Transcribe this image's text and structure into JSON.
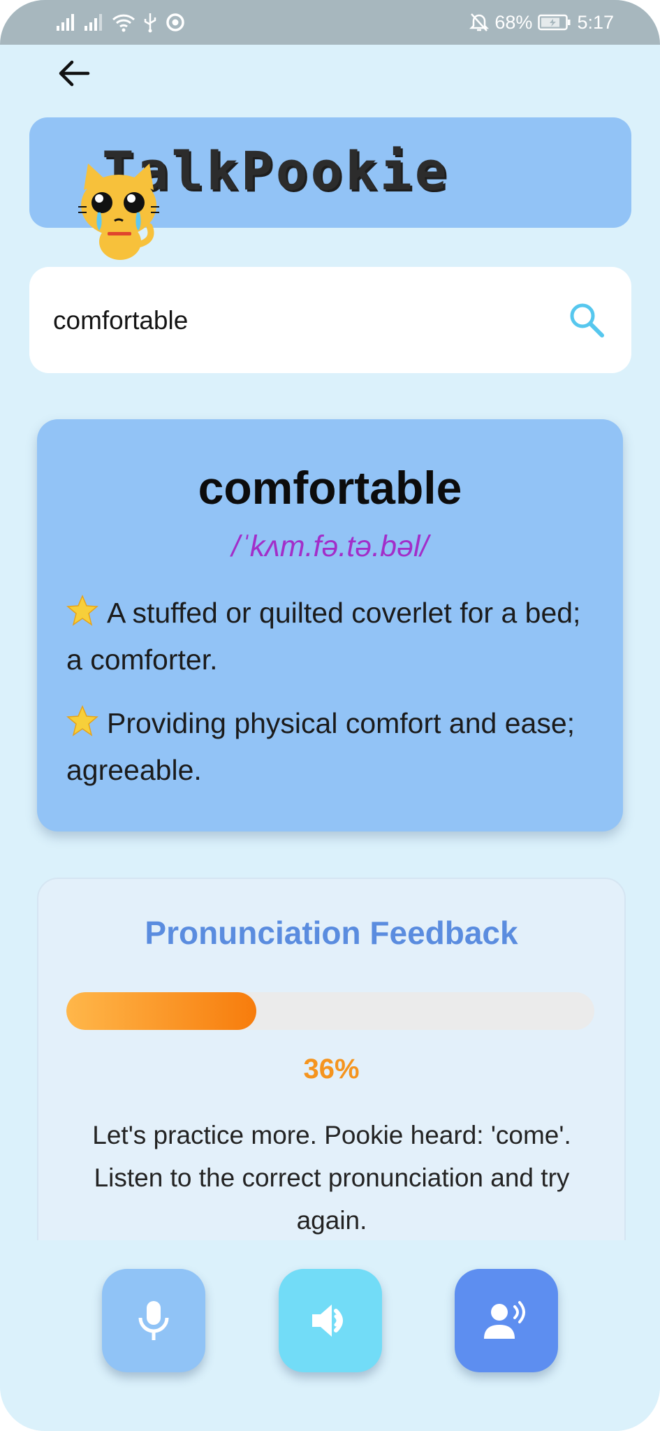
{
  "status_bar": {
    "battery": "68%",
    "time": "5:17",
    "icons": [
      "signal-icon",
      "signal-icon-2",
      "wifi-icon",
      "usb-icon",
      "sync-icon",
      "mute-icon",
      "battery-icon"
    ]
  },
  "header": {
    "back_icon": "arrow-left-icon",
    "app_title": "TalkPookie",
    "mascot": "crying-cat-mascot"
  },
  "search": {
    "value": "comfortable",
    "icon": "search-icon"
  },
  "definition_card": {
    "word": "comfortable",
    "phonetic": "/ˈkʌm.fə.tə.bəl/",
    "definitions": [
      "A stuffed or quilted coverlet for a bed; a comforter.",
      "Providing physical comfort and ease; agreeable."
    ],
    "bullet_icon": "star-icon"
  },
  "feedback": {
    "title": "Pronunciation Feedback",
    "score_fraction": 0.36,
    "percent_label": "36%",
    "message": "Let's practice more. Pookie heard: 'come'. Listen to the correct pronunciation and try again."
  },
  "actions": [
    {
      "name": "record-button",
      "icon": "microphone-icon"
    },
    {
      "name": "play-pronunciation-button",
      "icon": "speaker-icon"
    },
    {
      "name": "voice-mode-button",
      "icon": "person-voice-icon"
    }
  ],
  "colors": {
    "background": "#dbf1fb",
    "card_blue": "#92c3f6",
    "phonetic_purple": "#a22ec9",
    "feedback_title": "#5a8cdf",
    "progress_orange": "#f77c0c",
    "percent_orange": "#f5941e",
    "mic_button": "#90c3f6",
    "speaker_button": "#72dcf7",
    "voice_button": "#5d8ef0"
  }
}
